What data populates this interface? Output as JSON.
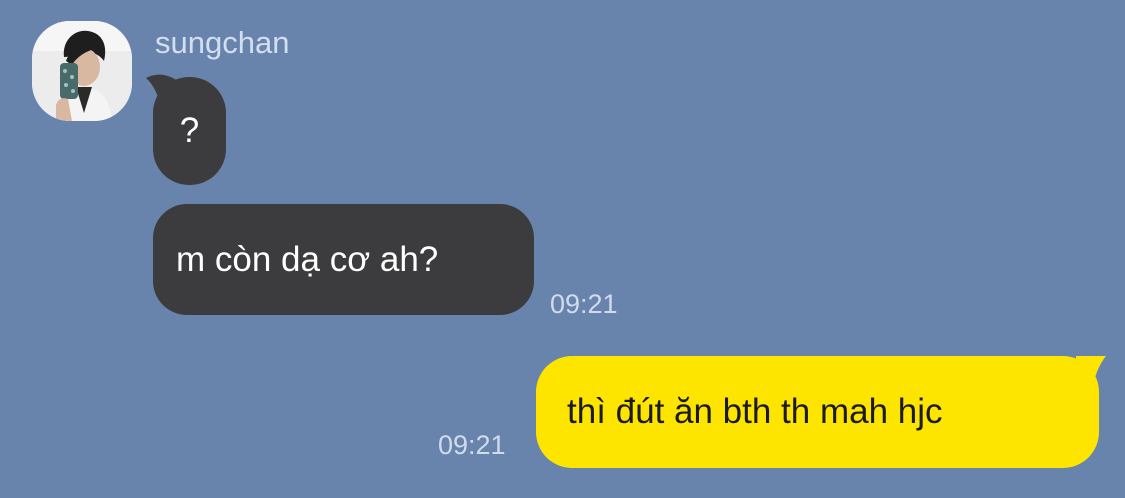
{
  "chat": {
    "sender": {
      "name": "sungchan",
      "avatar_icon": "profile-photo"
    },
    "messages": [
      {
        "direction": "incoming",
        "text": "?"
      },
      {
        "direction": "incoming",
        "text": "m còn dạ cơ ah?",
        "time": "09:21"
      },
      {
        "direction": "outgoing",
        "text": "thì đút ăn bth th mah hjc",
        "time": "09:21"
      }
    ]
  },
  "colors": {
    "background": "#6884ad",
    "incoming_bubble": "#3c3c3e",
    "outgoing_bubble": "#fee500",
    "timestamp_text": "#d0dbeb"
  }
}
